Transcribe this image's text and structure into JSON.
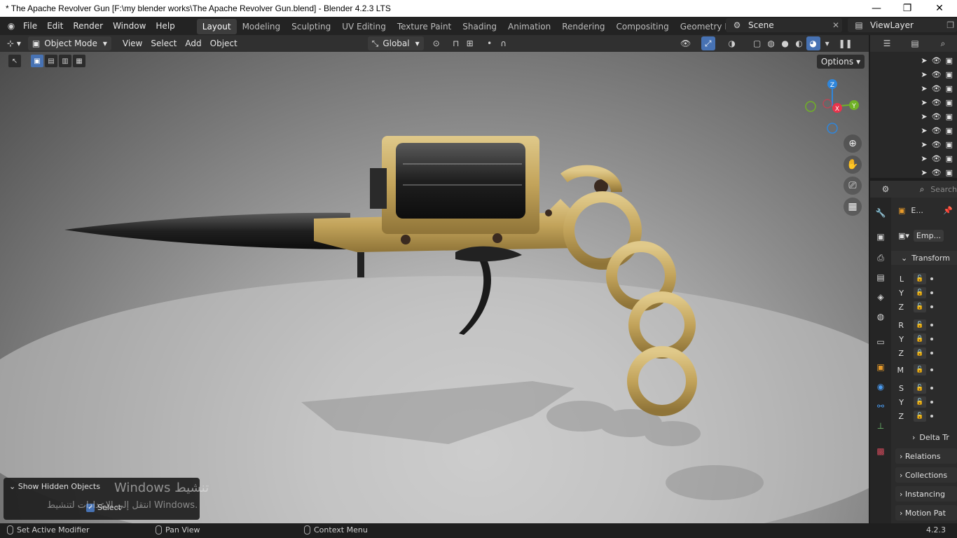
{
  "window": {
    "title": "* The Apache Revolver Gun [F:\\my blender works\\The Apache Revolver Gun.blend] - Blender 4.2.3 LTS",
    "minimize": "—",
    "maximize": "❐",
    "close": "✕"
  },
  "menubar": {
    "items": [
      "File",
      "Edit",
      "Render",
      "Window",
      "Help"
    ],
    "workspaces": [
      "Layout",
      "Modeling",
      "Sculpting",
      "UV Editing",
      "Texture Paint",
      "Shading",
      "Animation",
      "Rendering",
      "Compositing",
      "Geometry Nodes"
    ],
    "active_workspace": "Layout",
    "scene": "Scene",
    "view_layer": "ViewLayer"
  },
  "viewport_header": {
    "mode": "Object Mode",
    "menus": [
      "View",
      "Select",
      "Add",
      "Object"
    ],
    "orientation": "Global",
    "options": "Options"
  },
  "gizmo": {
    "z": "Z",
    "x": "X",
    "y": "Y"
  },
  "operator_panel": {
    "title": "Show Hidden Objects",
    "checkbox_label": "Select",
    "checked": true
  },
  "watermark": {
    "line1": "Windows تنشيط",
    "line2": "انتقل إلى الإعدادات لتنشيط Windows."
  },
  "outliner": {
    "row_count": 9
  },
  "properties": {
    "search_placeholder": "Search",
    "object_name": "E...",
    "data_name": "Emp...",
    "transform_title": "Transform",
    "rows": [
      {
        "label": "L",
        "locked": false
      },
      {
        "label": "Y",
        "locked": false
      },
      {
        "label": "Z",
        "locked": false
      },
      {
        "label": "R",
        "locked": false
      },
      {
        "label": "Y",
        "locked": true
      },
      {
        "label": "Z",
        "locked": true
      },
      {
        "label": "M",
        "locked": false
      },
      {
        "label": "S",
        "locked": false
      },
      {
        "label": "Y",
        "locked": false
      },
      {
        "label": "Z",
        "locked": false
      }
    ],
    "delta": "Delta Tr",
    "sections": [
      "Relations",
      "Collections",
      "Instancing",
      "Motion Pat"
    ]
  },
  "statusbar": {
    "left": "Set Active Modifier",
    "middle": "Pan View",
    "right": "Context Menu",
    "version": "4.2.3"
  },
  "colors": {
    "accent": "#4772b3",
    "axis_x": "#e8344c",
    "axis_y": "#70b127",
    "axis_z": "#2f86db",
    "brass": "#c8a85c"
  }
}
